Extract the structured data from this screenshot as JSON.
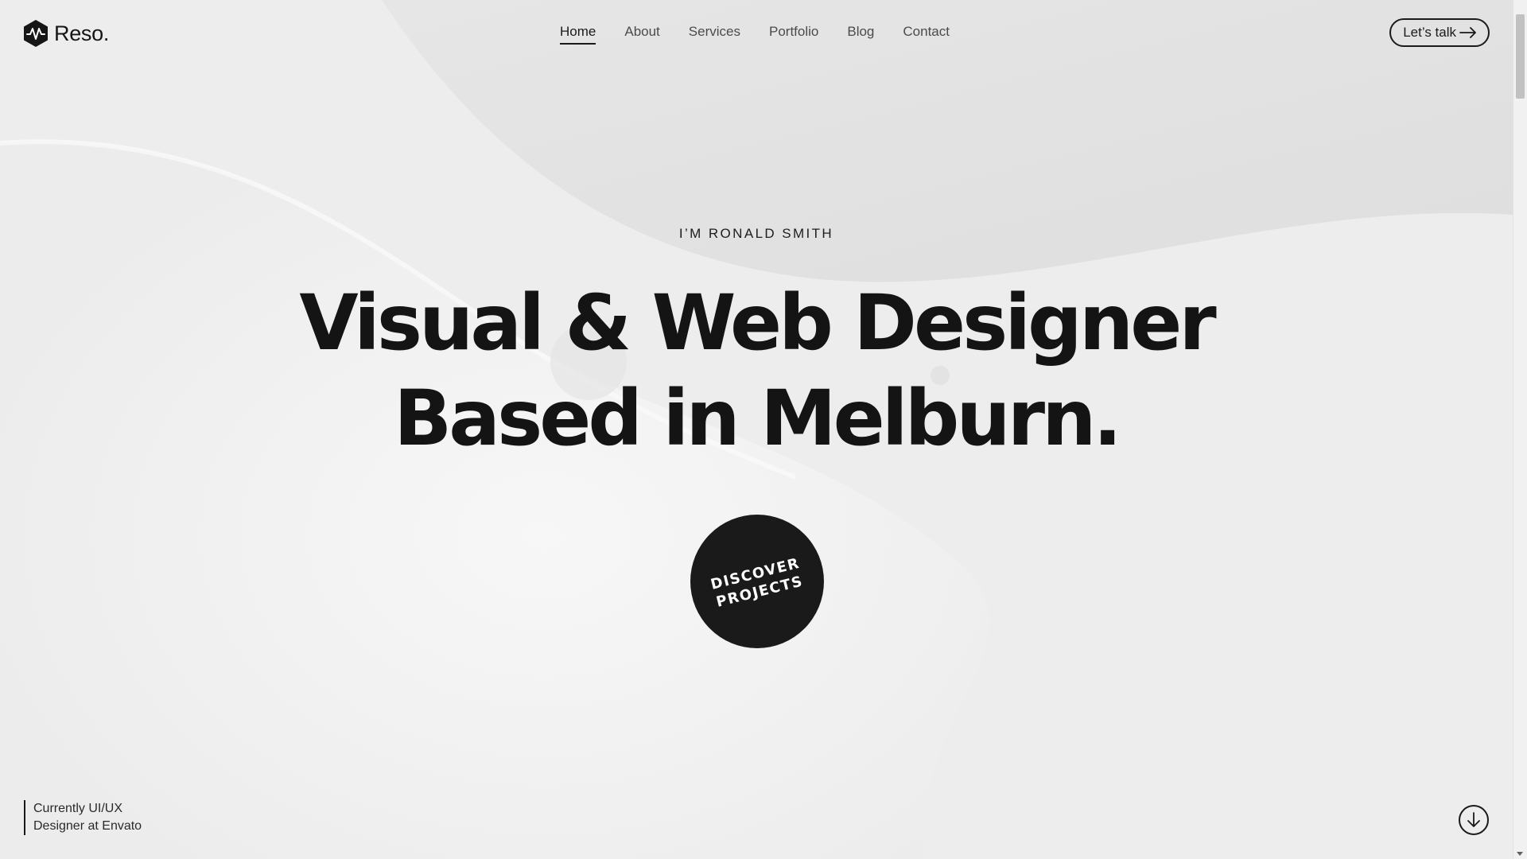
{
  "header": {
    "logo_text": "Reso.",
    "logo_icon": "wave-hexagon-icon",
    "nav": [
      {
        "label": "Home",
        "active": true
      },
      {
        "label": "About",
        "active": false
      },
      {
        "label": "Services",
        "active": false
      },
      {
        "label": "Portfolio",
        "active": false
      },
      {
        "label": "Blog",
        "active": false
      },
      {
        "label": "Contact",
        "active": false
      }
    ],
    "cta_label": "Let’s talk",
    "cta_icon": "arrow-right-icon"
  },
  "hero": {
    "eyebrow": "I’M RONALD SMITH",
    "headline_line1": "Visual & Web Designer",
    "headline_line2": "Based in Melburn.",
    "discover_line1": "DISCOVER",
    "discover_line2": "PROJECTS"
  },
  "footer": {
    "status_line1": "Currently UI/UX",
    "status_line2": "Designer at Envato",
    "scroll_icon": "arrow-down-circle-icon"
  },
  "colors": {
    "background": "#ececec",
    "text": "#141414",
    "accent_dark": "#1a1a1a"
  }
}
